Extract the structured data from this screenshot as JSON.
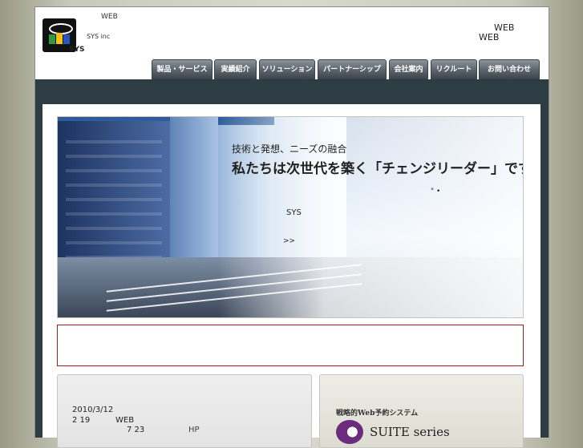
{
  "header": {
    "tag_web": "WEB",
    "tag_company": "SYS inc",
    "logo_text": "SYS",
    "right_web_1": "WEB",
    "right_web_2": "WEB"
  },
  "nav": {
    "items": [
      {
        "label": "製品・サービス"
      },
      {
        "label": "実績紹介"
      },
      {
        "label": "ソリューション"
      },
      {
        "label": "パートナーシップ"
      },
      {
        "label": "会社案内"
      },
      {
        "label": "リクルート"
      },
      {
        "label": "お問い合わせ"
      }
    ]
  },
  "hero": {
    "subtitle": "技術と発想、ニーズの融合",
    "title": "私たちは次世代を築く「チェンジリーダー」です",
    "dots": "\" •",
    "company": "SYS",
    "more": ">>"
  },
  "news": {
    "date": "2010/3/12",
    "line2_a": "2 19",
    "line2_b": "WEB",
    "line3_a": "7 23",
    "line3_b": "HP"
  },
  "ad": {
    "subtitle": "戦略的Web予約システム",
    "title": "SUITE series",
    "icon": "suite-logo-icon"
  },
  "colors": {
    "nav_bg": "#5a636b",
    "band": "#2e3c44",
    "notice_border": "#a51c1c"
  }
}
